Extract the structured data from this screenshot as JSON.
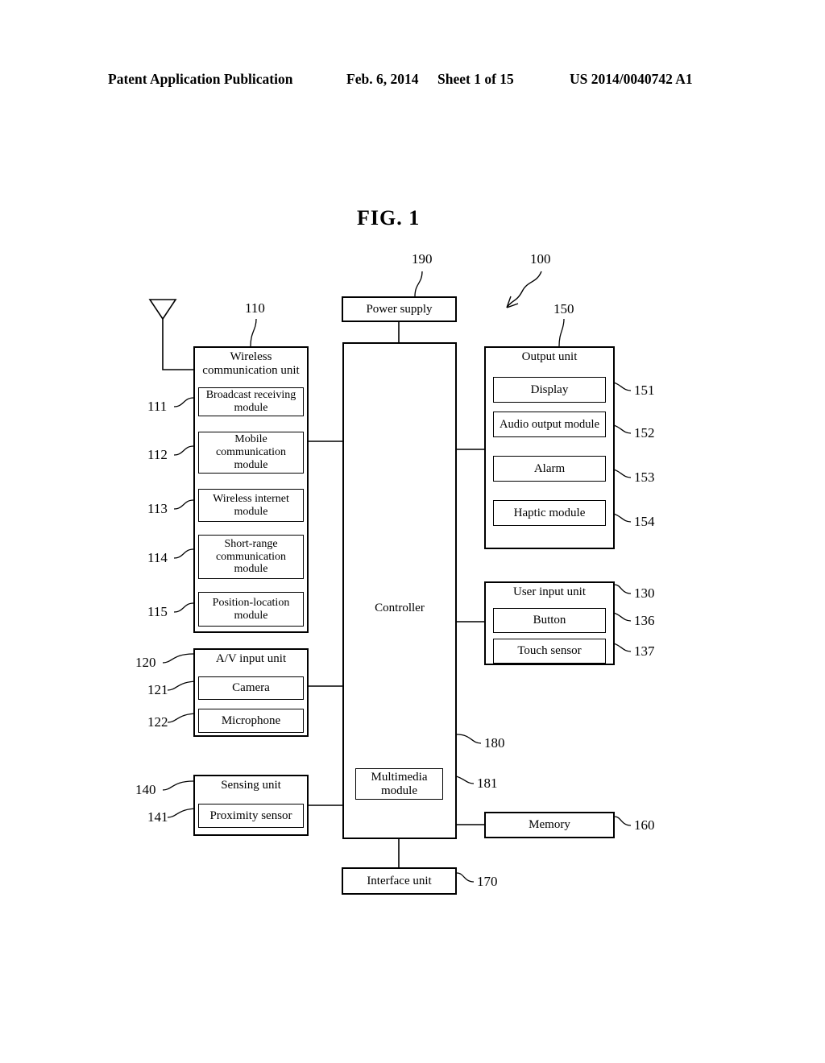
{
  "header": {
    "publication": "Patent Application Publication",
    "date": "Feb. 6, 2014",
    "sheet": "Sheet 1 of 15",
    "number": "US 2014/0040742 A1"
  },
  "figure": {
    "title": "FIG. 1",
    "device_ref": "100"
  },
  "blocks": {
    "power_supply": {
      "label": "Power supply",
      "ref": "190"
    },
    "controller": {
      "label": "Controller",
      "ref": "180"
    },
    "multimedia_module": {
      "label": "Multimedia\nmodule",
      "label_line1": "Multimedia",
      "label_line2": "module",
      "ref": "181"
    },
    "memory": {
      "label": "Memory",
      "ref": "160"
    },
    "interface_unit": {
      "label": "Interface unit",
      "ref": "170"
    },
    "wireless_communication_unit": {
      "title_line1": "Wireless",
      "title_line2": "communication unit",
      "ref": "110",
      "modules": [
        {
          "label_line1": "Broadcast receiving",
          "label_line2": "module",
          "label_line3": "",
          "ref": "111"
        },
        {
          "label_line1": "Mobile",
          "label_line2": "communication",
          "label_line3": "module",
          "ref": "112"
        },
        {
          "label_line1": "Wireless internet",
          "label_line2": "module",
          "label_line3": "",
          "ref": "113"
        },
        {
          "label_line1": "Short-range",
          "label_line2": "communication",
          "label_line3": "module",
          "ref": "114"
        },
        {
          "label_line1": "Position-location",
          "label_line2": "module",
          "label_line3": "",
          "ref": "115"
        }
      ]
    },
    "av_input_unit": {
      "title": "A/V input unit",
      "ref": "120",
      "modules": [
        {
          "label": "Camera",
          "ref": "121"
        },
        {
          "label": "Microphone",
          "ref": "122"
        }
      ]
    },
    "sensing_unit": {
      "title": "Sensing unit",
      "ref": "140",
      "modules": [
        {
          "label": "Proximity sensor",
          "ref": "141"
        }
      ]
    },
    "output_unit": {
      "title": "Output unit",
      "ref": "150",
      "modules": [
        {
          "label": "Display",
          "ref": "151"
        },
        {
          "label": "Audio output module",
          "ref": "152"
        },
        {
          "label": "Alarm",
          "ref": "153"
        },
        {
          "label": "Haptic module",
          "ref": "154"
        }
      ]
    },
    "user_input_unit": {
      "title": "User input unit",
      "ref": "130",
      "modules": [
        {
          "label": "Button",
          "ref": "136"
        },
        {
          "label": "Touch sensor",
          "ref": "137"
        }
      ]
    }
  }
}
